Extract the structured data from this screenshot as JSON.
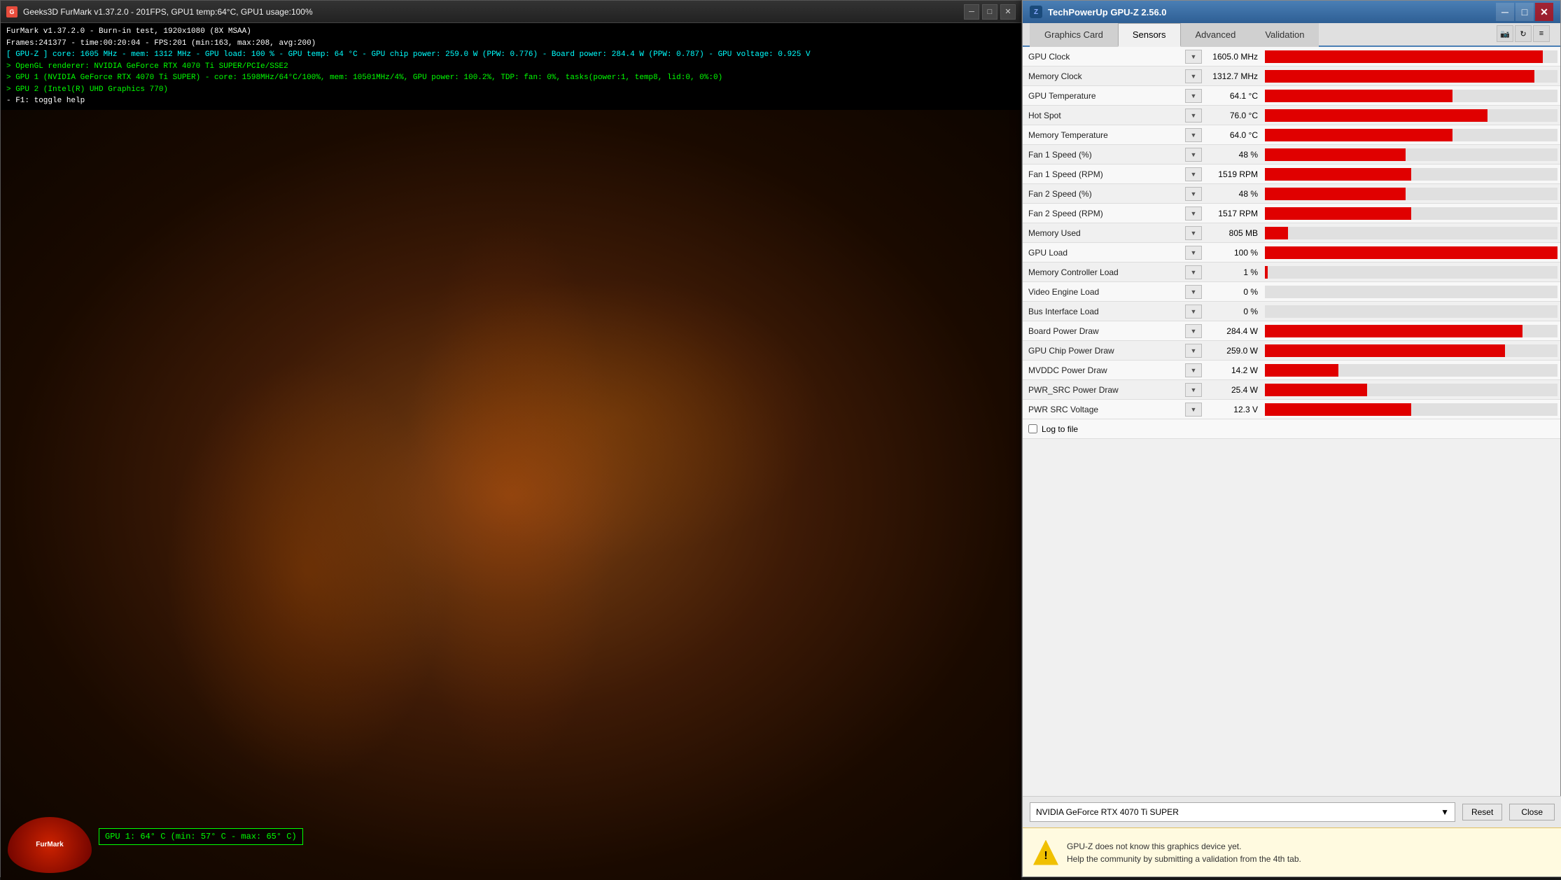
{
  "furmark": {
    "title": "Geeks3D FurMark v1.37.2.0 - 201FPS, GPU1 temp:64°C, GPU1 usage:100%",
    "info_lines": [
      {
        "text": "FurMark v1.37.2.0 - Burn-in test, 1920x1080 (8X MSAA)",
        "color": "white"
      },
      {
        "text": "Frames:241377 - time:00:20:04 - FPS:201 (min:163, max:208, avg:200)",
        "color": "white"
      },
      {
        "text": "[ GPU-Z ] core: 1605 MHz - mem: 1312 MHz - GPU load: 100 % - GPU temp: 64 °C - GPU chip power: 259.0 W (PPW: 0.776) - Board power: 284.4 W (PPW: 0.787) - GPU voltage: 0.925 V",
        "color": "cyan"
      },
      {
        "text": "> OpenGL renderer: NVIDIA GeForce RTX 4070 Ti SUPER/PCIe/SSE2",
        "color": "green"
      },
      {
        "text": "> GPU 1 (NVIDIA GeForce RTX 4070 Ti SUPER) - core: 1598MHz/64°C/100%, mem: 10501MHz/4%, GPU power: 100.2%, TDP: fan: 0%, tasks(power:1, temp8, lid:0, 0%:0)",
        "color": "green"
      },
      {
        "text": "> GPU 2 (Intel(R) UHD Graphics 770)",
        "color": "green"
      },
      {
        "text": "- F1: toggle help",
        "color": "white"
      }
    ],
    "gpu_temp_overlay": "GPU 1: 64° C (min: 57° C - max: 65° C)"
  },
  "gpuz": {
    "title": "TechPowerUp GPU-Z 2.56.0",
    "tabs": [
      "Graphics Card",
      "Sensors",
      "Advanced",
      "Validation"
    ],
    "active_tab": "Sensors",
    "toolbar_icons": [
      "camera-icon",
      "refresh-icon",
      "menu-icon"
    ],
    "sensors": [
      {
        "name": "GPU Clock",
        "value": "1605.0 MHz",
        "bar_pct": 95
      },
      {
        "name": "Memory Clock",
        "value": "1312.7 MHz",
        "bar_pct": 92
      },
      {
        "name": "GPU Temperature",
        "value": "64.1 °C",
        "bar_pct": 64
      },
      {
        "name": "Hot Spot",
        "value": "76.0 °C",
        "bar_pct": 76
      },
      {
        "name": "Memory Temperature",
        "value": "64.0 °C",
        "bar_pct": 64
      },
      {
        "name": "Fan 1 Speed (%)",
        "value": "48 %",
        "bar_pct": 48
      },
      {
        "name": "Fan 1 Speed (RPM)",
        "value": "1519 RPM",
        "bar_pct": 50
      },
      {
        "name": "Fan 2 Speed (%)",
        "value": "48 %",
        "bar_pct": 48
      },
      {
        "name": "Fan 2 Speed (RPM)",
        "value": "1517 RPM",
        "bar_pct": 50
      },
      {
        "name": "Memory Used",
        "value": "805 MB",
        "bar_pct": 8
      },
      {
        "name": "GPU Load",
        "value": "100 %",
        "bar_pct": 100
      },
      {
        "name": "Memory Controller Load",
        "value": "1 %",
        "bar_pct": 1
      },
      {
        "name": "Video Engine Load",
        "value": "0 %",
        "bar_pct": 0
      },
      {
        "name": "Bus Interface Load",
        "value": "0 %",
        "bar_pct": 0
      },
      {
        "name": "Board Power Draw",
        "value": "284.4 W",
        "bar_pct": 88
      },
      {
        "name": "GPU Chip Power Draw",
        "value": "259.0 W",
        "bar_pct": 82
      },
      {
        "name": "MVDDC Power Draw",
        "value": "14.2 W",
        "bar_pct": 25
      },
      {
        "name": "PWR_SRC Power Draw",
        "value": "25.4 W",
        "bar_pct": 35
      },
      {
        "name": "PWR  SRC Voltage",
        "value": "12.3 V",
        "bar_pct": 50
      }
    ],
    "log_to_file_label": "Log to file",
    "device_name": "NVIDIA GeForce RTX 4070 Ti SUPER",
    "reset_label": "Reset",
    "close_label": "Close",
    "notification": {
      "text1": "GPU-Z does not know this graphics device yet.",
      "text2": "Help the community by submitting a validation from the 4th tab."
    }
  }
}
